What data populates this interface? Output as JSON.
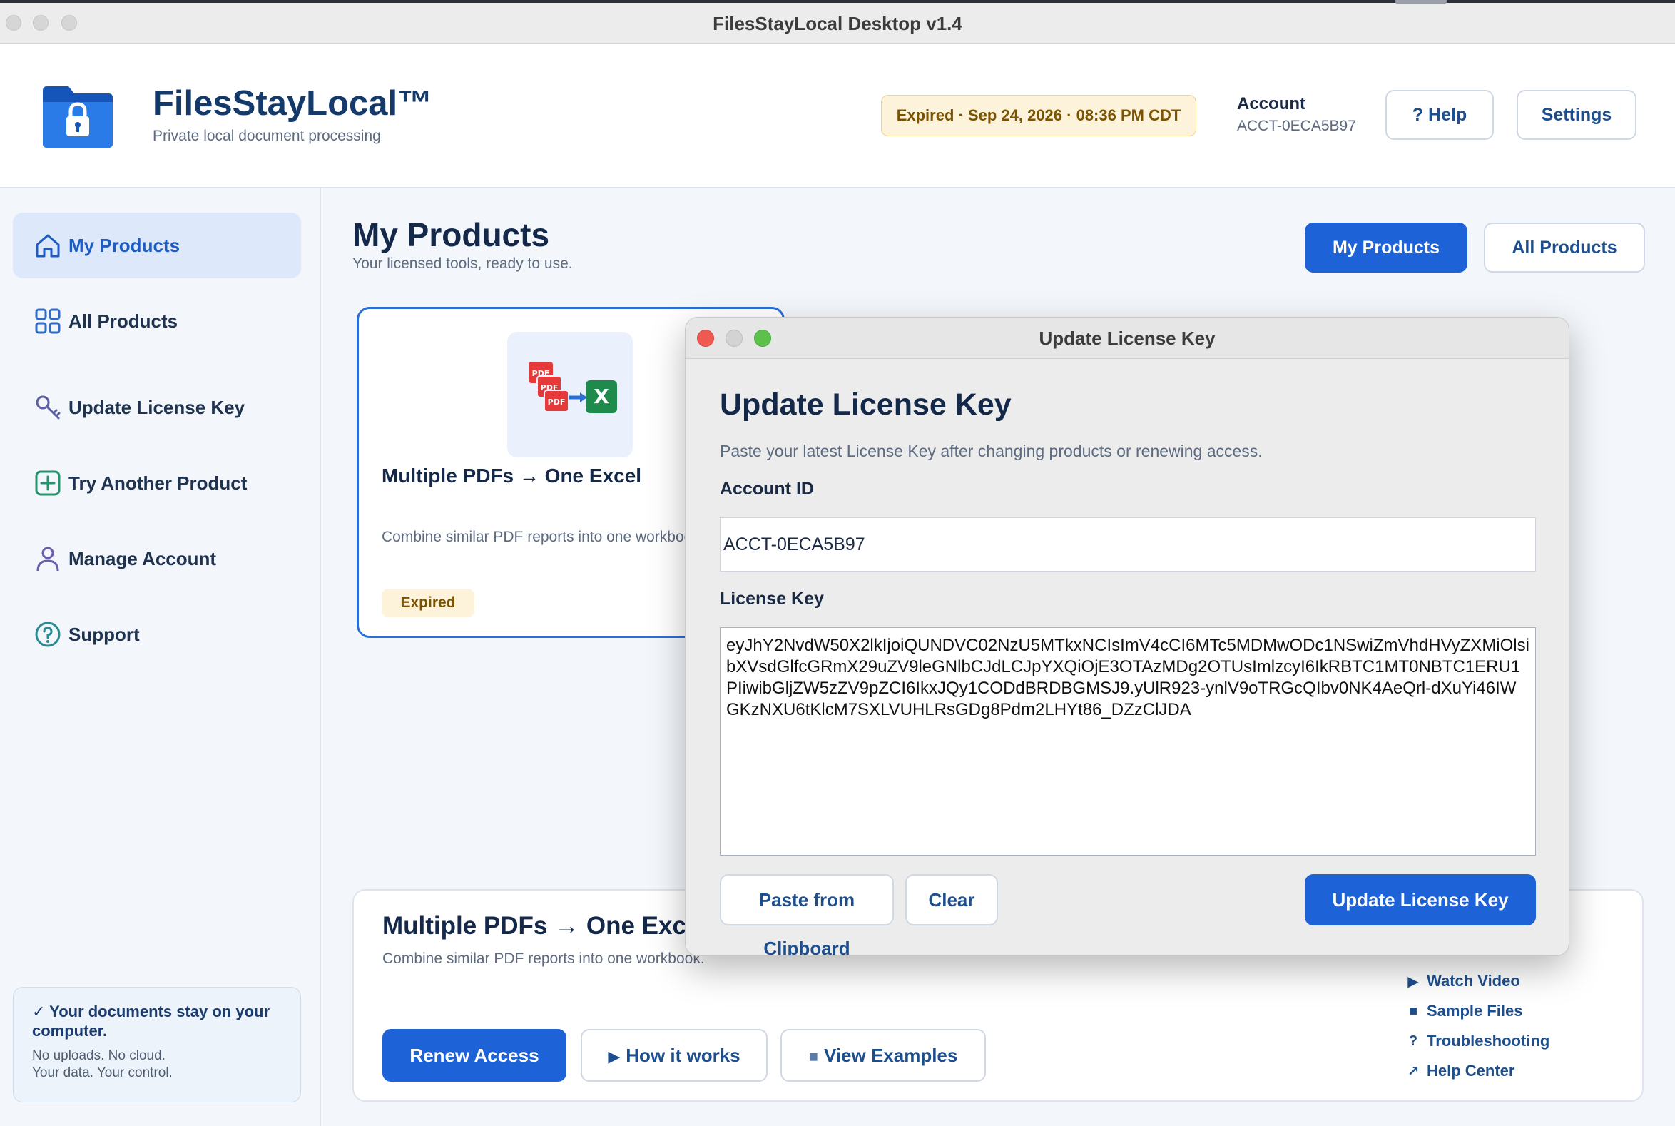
{
  "window": {
    "title": "FilesStayLocal Desktop v1.4"
  },
  "header": {
    "brand": "FilesStayLocal™",
    "tagline": "Private local document processing",
    "status_badge": "Expired · Sep 24, 2026 · 08:36 PM CDT",
    "account_label": "Account",
    "account_id": "ACCT-0ECA5B97",
    "help_label": "? Help",
    "settings_label": "Settings"
  },
  "sidebar": {
    "items": [
      {
        "label": "My Products",
        "icon": "home-icon",
        "active": true
      },
      {
        "label": "All Products",
        "icon": "grid-icon"
      },
      {
        "label": "Update License Key",
        "icon": "key-icon"
      },
      {
        "label": "Try Another Product",
        "icon": "plus-square-icon"
      },
      {
        "label": "Manage Account",
        "icon": "user-icon"
      },
      {
        "label": "Support",
        "icon": "question-circle-icon"
      }
    ],
    "privacy": {
      "headline": "✓ Your documents stay on your computer.",
      "line1": "No uploads. No cloud.",
      "line2": "Your data. Your control."
    }
  },
  "main": {
    "title": "My Products",
    "subtitle": "Your licensed tools, ready to use.",
    "view_toggle": {
      "my_products": "My Products",
      "all_products": "All Products"
    },
    "product_card": {
      "name": "Multiple PDFs → One Excel",
      "description": "Combine similar PDF reports into one workbook.",
      "status": "Expired",
      "thumb_labels": [
        "PDF",
        "PDF",
        "PDF",
        "X"
      ]
    },
    "detail": {
      "title": "Multiple PDFs → One Excel",
      "description": "Combine similar PDF reports into one workbook.",
      "renew_label": "Renew Access",
      "how_label": "How it works",
      "examples_label": "View Examples",
      "links": [
        {
          "glyph": "▶",
          "label": "Watch Video"
        },
        {
          "glyph": "■",
          "label": "Sample Files"
        },
        {
          "glyph": "?",
          "label": "Troubleshooting"
        },
        {
          "glyph": "↗",
          "label": "Help Center"
        }
      ]
    }
  },
  "modal": {
    "window_title": "Update License Key",
    "heading": "Update License Key",
    "subtitle": "Paste your latest License Key after changing products or renewing access.",
    "account_label": "Account ID",
    "account_value": "ACCT-0ECA5B97",
    "key_label": "License Key",
    "key_value": "eyJhY2NvdW50X2lkIjoiQUNDVC02NzU5MTkxNCIsImV4cCI6MTc5MDMwODc1NSwiZmVhdHVyZXMiOlsibXVsdGlfcGRmX29uZV9leGNlbCJdLCJpYXQiOjE3OTAzMDg2OTUsImlzcyI6IkRBTC1MT0NBTC1ERU1PIiwibGljZW5zZV9pZCI6IkxJQy1CODdBRDBGMSJ9.yUlR923-ynlV9oTRGcQIbv0NK4AeQrl-dXuYi46IWGKzNXU6tKlcM7SXLVUHLRsGDg8Pdm2LHYt86_DZzClJDA",
    "paste_label": "Paste from Clipboard",
    "clear_label": "Clear",
    "submit_label": "Update License Key"
  }
}
